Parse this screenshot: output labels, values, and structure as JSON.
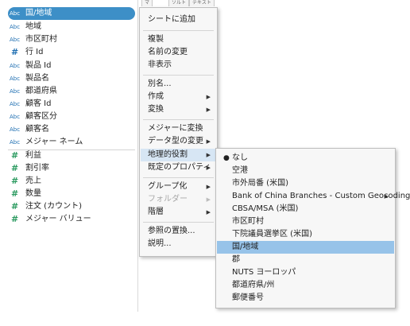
{
  "top_tabs": [
    "マ",
    "ソルト",
    "テキスト"
  ],
  "data_pane": {
    "dimension_icon": "Abc",
    "measure_icon": "#",
    "dimensions": [
      {
        "label": "国/地域",
        "selected": true
      },
      {
        "label": "地域"
      },
      {
        "label": "市区町村"
      },
      {
        "label": "行 Id",
        "icon": "#"
      },
      {
        "label": "製品 Id"
      },
      {
        "label": "製品名"
      },
      {
        "label": "都道府県"
      },
      {
        "label": "顧客 Id"
      },
      {
        "label": "顧客区分"
      },
      {
        "label": "顧客名"
      },
      {
        "label": "メジャー ネーム"
      }
    ],
    "measures": [
      {
        "label": "利益"
      },
      {
        "label": "割引率"
      },
      {
        "label": "売上"
      },
      {
        "label": "数量"
      },
      {
        "label": "注文 (カウント)"
      },
      {
        "label": "メジャー バリュー"
      }
    ]
  },
  "context_menu": {
    "items": [
      {
        "label": "シートに追加"
      },
      {
        "label": "複製"
      },
      {
        "label": "名前の変更"
      },
      {
        "label": "非表示"
      },
      {
        "label": "別名..."
      },
      {
        "label": "作成",
        "submenu": true
      },
      {
        "label": "変換",
        "submenu": true
      },
      {
        "label": "メジャーに変換"
      },
      {
        "label": "データ型の変更",
        "submenu": true
      },
      {
        "label": "地理的役割",
        "submenu": true,
        "highlighted": true
      },
      {
        "label": "既定のプロパティ",
        "submenu": true
      },
      {
        "label": "グループ化",
        "submenu": true
      },
      {
        "label": "フォルダー",
        "submenu": true,
        "disabled": true
      },
      {
        "label": "階層",
        "submenu": true
      },
      {
        "label": "参照の置換..."
      },
      {
        "label": "説明..."
      }
    ],
    "arrow_glyph": "▶"
  },
  "geo_submenu": {
    "checked_glyph": "●",
    "items": [
      {
        "label": "なし",
        "checked": true
      },
      {
        "label": "空港"
      },
      {
        "label": "市外局番 (米国)"
      },
      {
        "label": "Bank of China Branches - Custom Geocoding",
        "submenu": true
      },
      {
        "label": "CBSA/MSA (米国)"
      },
      {
        "label": "市区町村"
      },
      {
        "label": "下院議員選挙区 (米国)"
      },
      {
        "label": "国/地域",
        "highlighted": true
      },
      {
        "label": "郡"
      },
      {
        "label": "NUTS ヨーロッパ"
      },
      {
        "label": "都道府県/州"
      },
      {
        "label": "郵便番号"
      }
    ]
  },
  "colors": {
    "selection_pill": "#3d8fc7",
    "menu_highlight": "#d7e6f4",
    "submenu_highlight": "#97c3e9",
    "dimension_icon": "#1f6fb2",
    "measure_icon": "#2a9a5f"
  }
}
